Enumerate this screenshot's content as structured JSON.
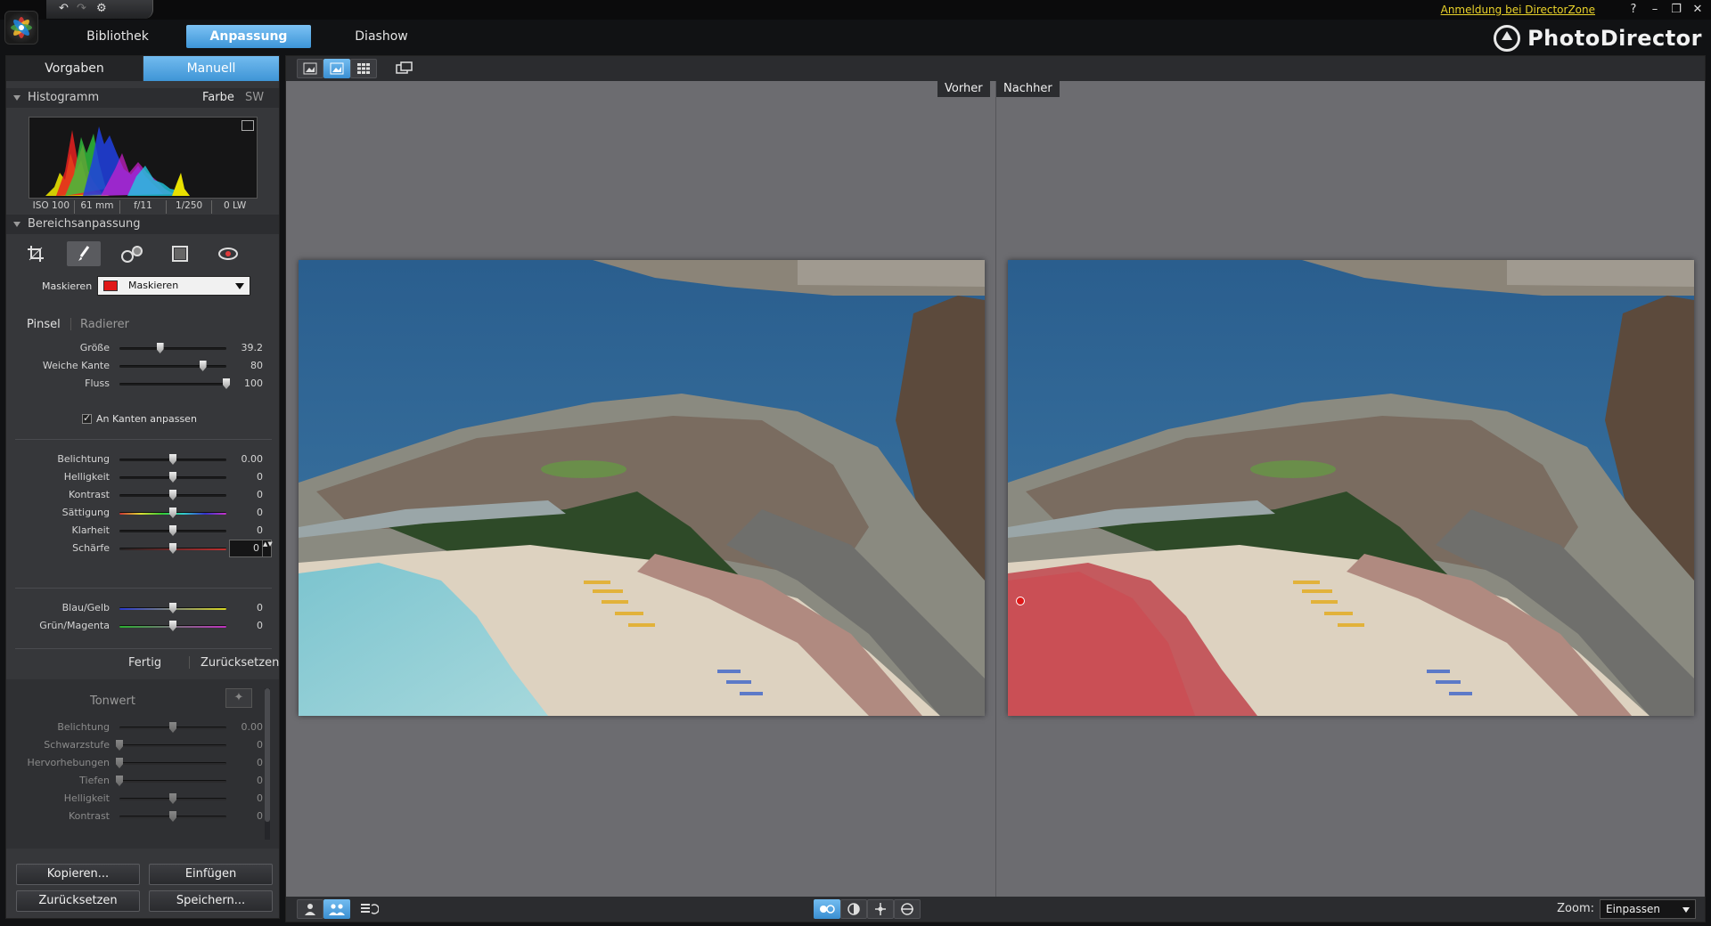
{
  "titlebar": {
    "directorzone_link": "Anmeldung bei DirectorZone",
    "help": "?",
    "minimize": "–",
    "restore": "❐",
    "close": "✕"
  },
  "nav": {
    "tabs": [
      {
        "label": "Bibliothek"
      },
      {
        "label": "Anpassung",
        "active": true
      },
      {
        "label": "Diashow"
      }
    ],
    "brand": "PhotoDirector"
  },
  "left": {
    "subtabs": [
      {
        "label": "Vorgaben"
      },
      {
        "label": "Manuell",
        "active": true
      }
    ],
    "histogram": {
      "title": "Histogramm",
      "mode_color": "Farbe",
      "mode_bw": "SW",
      "info": [
        "ISO 100",
        "61 mm",
        "f/11",
        "1/250",
        "0 LW"
      ]
    },
    "region": {
      "title": "Bereichsanpassung",
      "mask_label": "Maskieren",
      "mask_value": "Maskieren",
      "mask_color": "#e01818",
      "brush_tab": "Pinsel",
      "eraser_tab": "Radierer",
      "brush_sliders": [
        {
          "label": "Größe",
          "value": "39.2",
          "pos": 0.38
        },
        {
          "label": "Weiche Kante",
          "value": "80",
          "pos": 0.78
        },
        {
          "label": "Fluss",
          "value": "100",
          "pos": 1.0
        }
      ],
      "edge_checkbox": "An Kanten anpassen",
      "adjust_sliders": [
        {
          "label": "Belichtung",
          "value": "0.00",
          "pos": 0.5
        },
        {
          "label": "Helligkeit",
          "value": "0",
          "pos": 0.5
        },
        {
          "label": "Kontrast",
          "value": "0",
          "pos": 0.5
        },
        {
          "label": "Sättigung",
          "value": "0",
          "pos": 0.5
        },
        {
          "label": "Klarheit",
          "value": "0",
          "pos": 0.5
        },
        {
          "label": "Schärfe",
          "value": "0",
          "pos": 0.5
        }
      ],
      "color_sliders": [
        {
          "label": "Blau/Gelb",
          "value": "0",
          "pos": 0.5
        },
        {
          "label": "Grün/Magenta",
          "value": "0",
          "pos": 0.5
        }
      ],
      "done": "Fertig",
      "reset": "Zurücksetzen"
    },
    "tone": {
      "title": "Tonwert",
      "sliders": [
        {
          "label": "Belichtung",
          "value": "0.00",
          "pos": 0.5
        },
        {
          "label": "Schwarzstufe",
          "value": "0",
          "pos": 0.0
        },
        {
          "label": "Hervorhebungen",
          "value": "0",
          "pos": 0.0
        },
        {
          "label": "Tiefen",
          "value": "0",
          "pos": 0.0
        },
        {
          "label": "Helligkeit",
          "value": "0",
          "pos": 0.5
        },
        {
          "label": "Kontrast",
          "value": "0",
          "pos": 0.5
        }
      ]
    },
    "buttons": {
      "copy": "Kopieren...",
      "paste": "Einfügen",
      "reset": "Zurücksetzen",
      "save": "Speichern..."
    }
  },
  "viewer": {
    "before": "Vorher",
    "after": "Nachher",
    "zoom_label": "Zoom:",
    "zoom_value": "Einpassen"
  },
  "colors": {
    "accent": "#3d95d8",
    "mask": "#e01818"
  }
}
